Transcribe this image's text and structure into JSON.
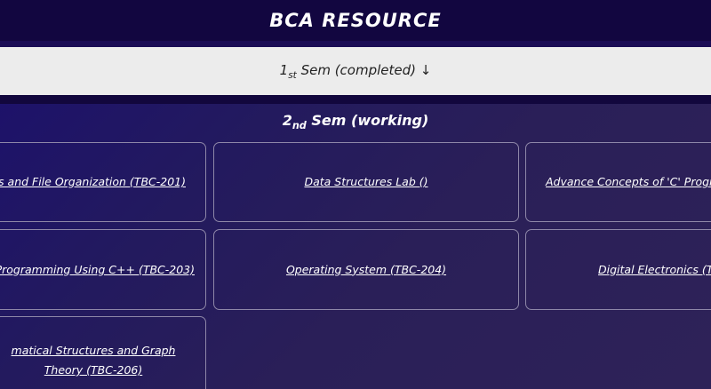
{
  "header": {
    "title": "BCA RESOURCE"
  },
  "sem1": {
    "num": "1",
    "sup": "st",
    "text": " Sem (completed) ↓"
  },
  "sem2": {
    "num": "2",
    "sup": "nd",
    "text": " Sem (working)"
  },
  "courses": [
    {
      "label": "s and File Organization (TBC-201)"
    },
    {
      "label": "Data Structures Lab ()"
    },
    {
      "label": "Advance Concepts of 'C' Progra"
    },
    {
      "label": "Programming Using C++ (TBC-203)"
    },
    {
      "label": "Operating System (TBC-204)"
    },
    {
      "label": "Digital Electronics (T"
    },
    {
      "label": "matical Structures and Graph Theory (TBC-206)"
    }
  ],
  "colors": {
    "header_bg": "#120640",
    "sem1_bg": "#ececec",
    "card_border": "#8e87a8",
    "text_light": "#ffffff"
  }
}
